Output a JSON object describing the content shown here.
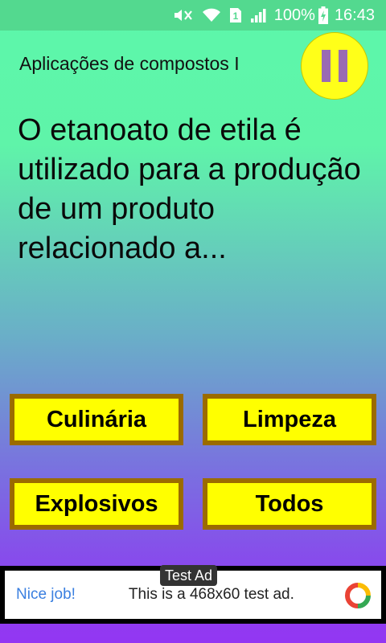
{
  "status_bar": {
    "battery": "100%",
    "time": "16:43",
    "sim_slot": "1",
    "icons": [
      "mute-icon",
      "wifi-icon",
      "sim-icon",
      "signal-icon",
      "battery-charging-icon"
    ]
  },
  "quiz": {
    "title": "Aplicações de compostos I",
    "question": "O etanoato de etila é utilizado para a produção de um produto relacionado a...",
    "answers": [
      "Culinária",
      "Limpeza",
      "Explosivos",
      "Todos"
    ],
    "pause_icon": "pause-icon"
  },
  "ad": {
    "badge": "Test Ad",
    "headline": "Nice job!",
    "message": "This is a 468x60 test ad.",
    "logo_icon": "ad-logo-icon"
  },
  "colors": {
    "answer_fill": "#ffff00",
    "answer_border": "#9b6b00",
    "pause_fill": "#ffff19",
    "pause_bars": "#9a6bb3",
    "background_top": "#5cf7aa",
    "background_bottom": "#9336f2"
  }
}
